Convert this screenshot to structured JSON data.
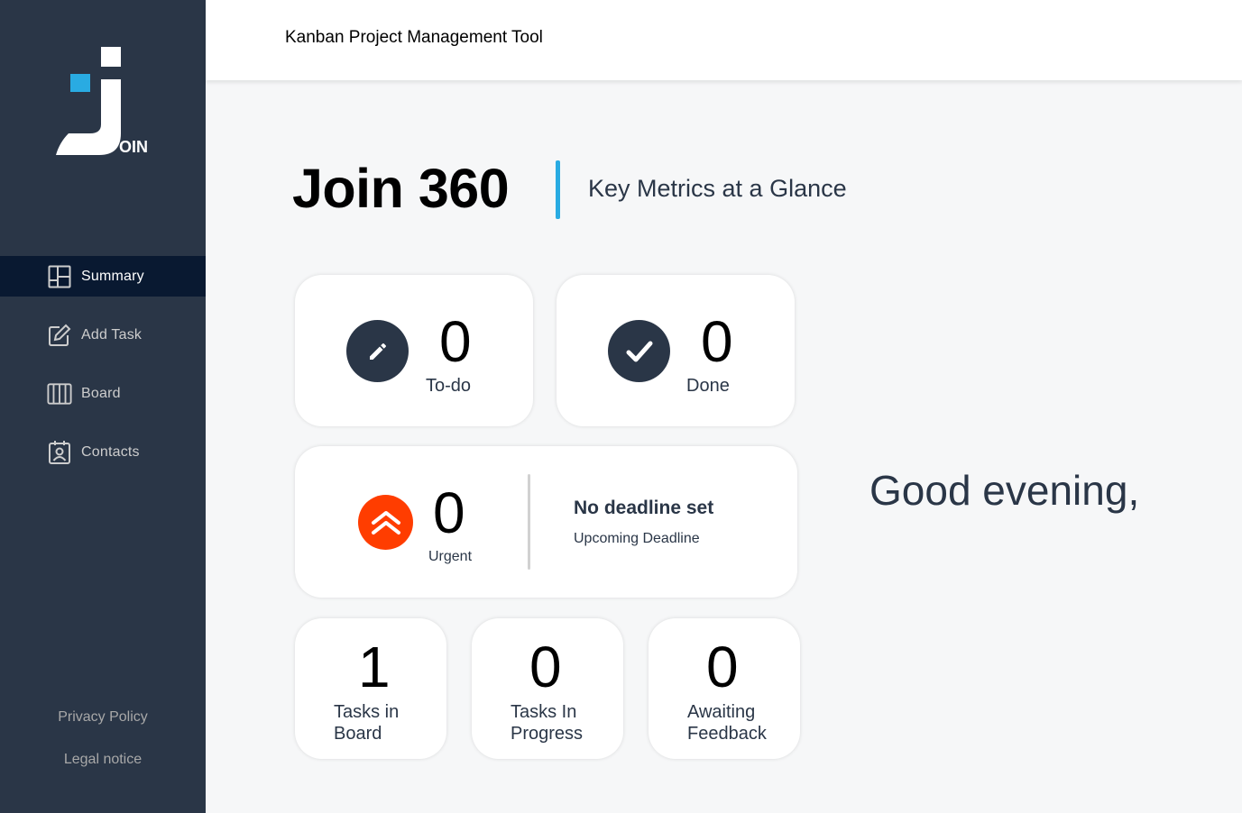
{
  "app": {
    "logo_text": "OIN",
    "header_title": "Kanban Project Management Tool"
  },
  "sidebar": {
    "items": [
      {
        "label": "Summary",
        "icon": "summary-icon",
        "active": true
      },
      {
        "label": "Add Task",
        "icon": "add-task-icon",
        "active": false
      },
      {
        "label": "Board",
        "icon": "board-icon",
        "active": false
      },
      {
        "label": "Contacts",
        "icon": "contacts-icon",
        "active": false
      }
    ],
    "footer": {
      "privacy": "Privacy Policy",
      "legal": "Legal notice"
    }
  },
  "summary": {
    "title": "Join 360",
    "subtitle": "Key Metrics at a Glance",
    "todo": {
      "count": "0",
      "label": "To-do"
    },
    "done": {
      "count": "0",
      "label": "Done"
    },
    "urgent": {
      "count": "0",
      "label": "Urgent",
      "deadline": "No deadline set",
      "deadline_label": "Upcoming Deadline"
    },
    "board": {
      "count": "1",
      "label_line1": "Tasks in",
      "label_line2": "Board"
    },
    "progress": {
      "count": "0",
      "label_line1": "Tasks In",
      "label_line2": "Progress"
    },
    "feedback": {
      "count": "0",
      "label_line1": "Awaiting",
      "label_line2": "Feedback"
    },
    "greeting": "Good evening,"
  },
  "colors": {
    "sidebar_bg": "#2a3647",
    "active_bg": "#091931",
    "accent": "#29abe2",
    "urgent": "#ff3d00"
  }
}
